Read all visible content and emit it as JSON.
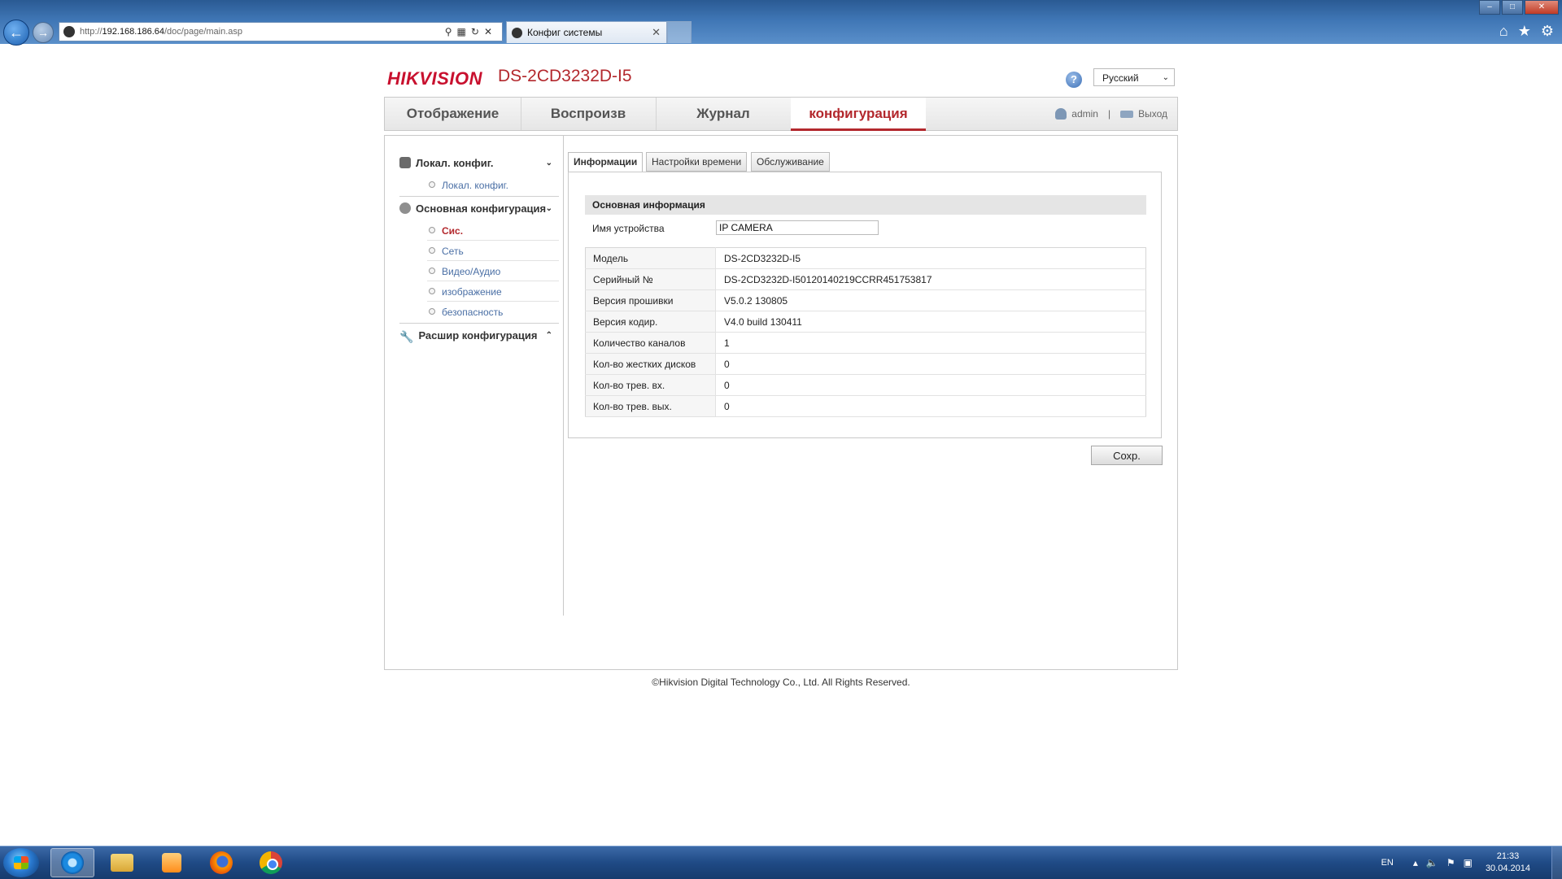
{
  "browser": {
    "url_prefix": "http://",
    "url_host": "192.168.186.64",
    "url_path": "/doc/page/main.asp",
    "tab_title": "Конфиг системы",
    "tab_close": "✕"
  },
  "header": {
    "logo": "HIKVISION",
    "model": "DS-2CD3232D-I5",
    "help": "?",
    "language": "Русский"
  },
  "nav": {
    "tabs": [
      "Отображение",
      "Воспроизв",
      "Журнал",
      "конфигурация"
    ],
    "active_tab": "конфигурация",
    "user": "admin",
    "separator": "|",
    "logout": "Выход"
  },
  "sidebar": {
    "groups": [
      {
        "label": "Локал. конфиг.",
        "chevron": "⌄",
        "items": [
          "Локал. конфиг."
        ]
      },
      {
        "label": "Основная конфигурация",
        "chevron": "⌄",
        "items": [
          "Сис.",
          "Сеть",
          "Видео/Аудио",
          "изображение",
          "безопасность"
        ]
      },
      {
        "label": "Расшир конфигурация",
        "chevron": "⌃",
        "items": []
      }
    ],
    "active_item": "Сис."
  },
  "subtabs": [
    "Информации",
    "Настройки времени",
    "Обслуживание"
  ],
  "info": {
    "section_title": "Основная информация",
    "device_name_label": "Имя устройства",
    "device_name_value": "IP CAMERA",
    "rows": [
      {
        "key": "Модель",
        "value": "DS-2CD3232D-I5"
      },
      {
        "key": "Серийный №",
        "value": "DS-2CD3232D-I50120140219CCRR451753817"
      },
      {
        "key": "Версия прошивки",
        "value": "V5.0.2 130805"
      },
      {
        "key": "Версия кодир.",
        "value": "V4.0 build 130411"
      },
      {
        "key": "Количество каналов",
        "value": "1"
      },
      {
        "key": "Кол-во жестких дисков",
        "value": "0"
      },
      {
        "key": "Кол-во трев. вх.",
        "value": "0"
      },
      {
        "key": "Кол-во трев. вых.",
        "value": "0"
      }
    ],
    "save_label": "Сохр."
  },
  "footer": "©Hikvision Digital Technology Co., Ltd. All Rights Reserved.",
  "taskbar": {
    "language": "EN",
    "time": "21:33",
    "date": "30.04.2014"
  },
  "colors": {
    "brand_red": "#c8102e",
    "active_red": "#b3282d",
    "link_blue": "#4a6fa5"
  }
}
